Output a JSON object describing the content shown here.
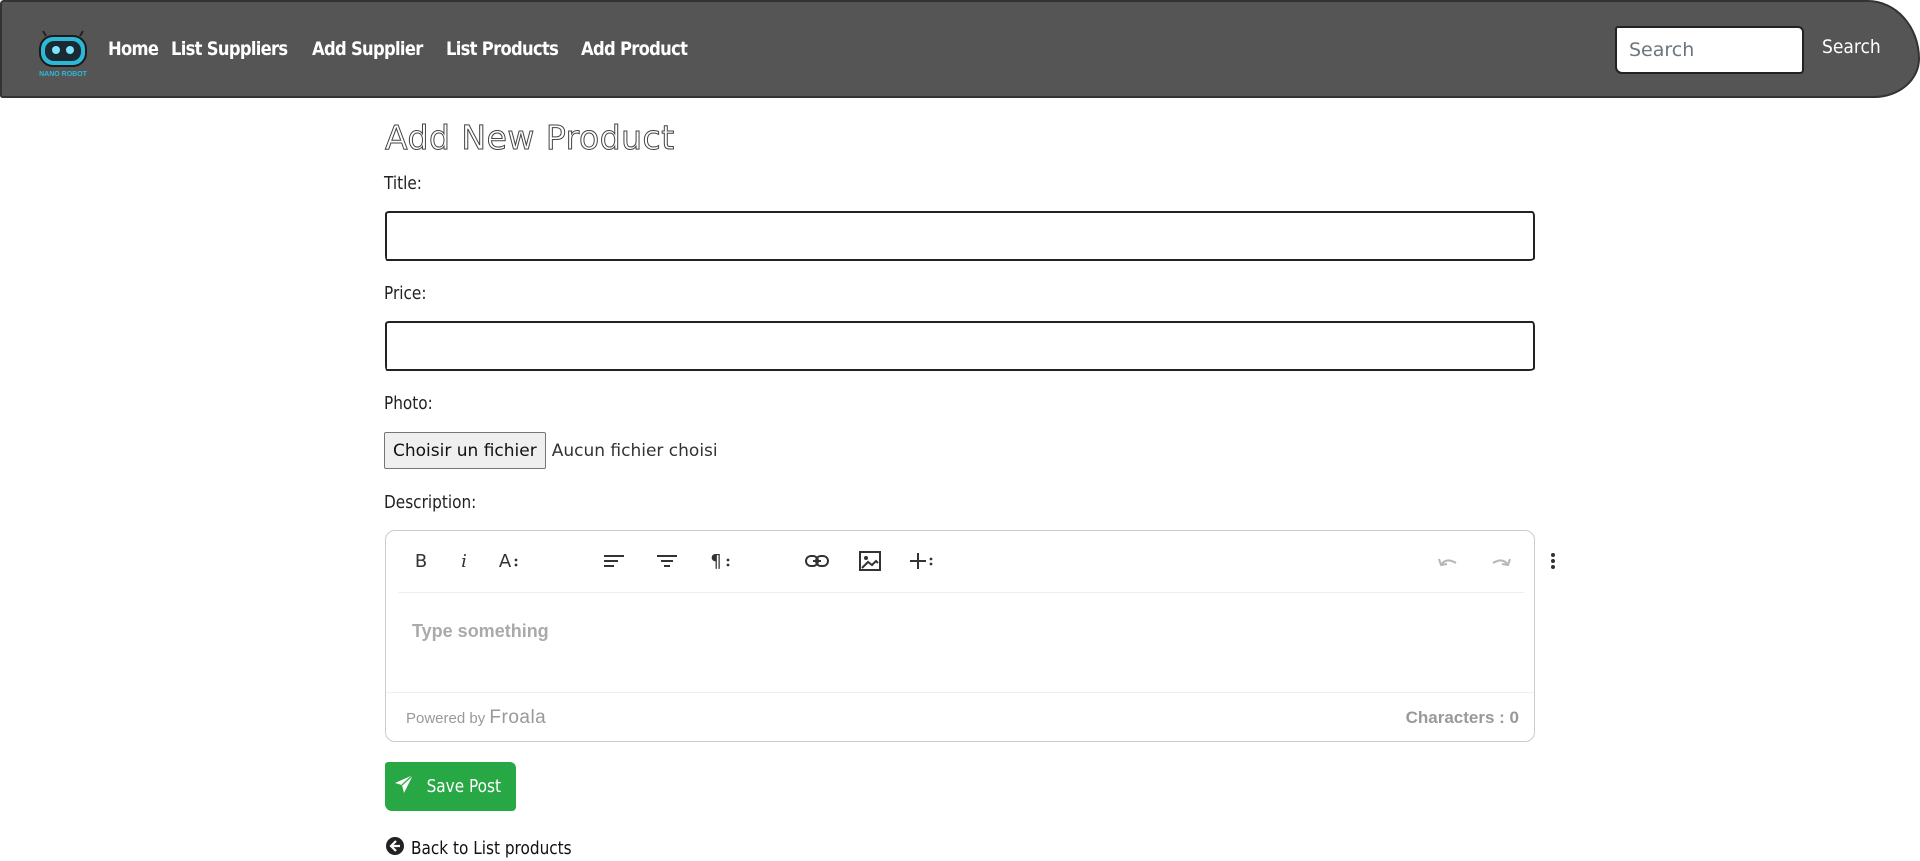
{
  "navbar": {
    "logo_text": "NANO ROBOT",
    "links": [
      "Home",
      "List Suppliers",
      "Add Supplier",
      "List Products",
      "Add Product"
    ],
    "search_placeholder": "Search",
    "search_button": "Search",
    "background_color": "#555555"
  },
  "form": {
    "page_title": "Add New Product",
    "title_label": "Title:",
    "title_value": "",
    "price_label": "Price:",
    "price_value": "",
    "photo_label": "Photo:",
    "file_button": "Choisir un fichier",
    "file_status": "Aucun fichier choisi",
    "description_label": "Description:"
  },
  "editor": {
    "toolbar": [
      "bold-icon",
      "italic-icon",
      "text-format-icon",
      "align-left-icon",
      "align-center-icon",
      "paragraph-format-icon",
      "link-icon",
      "image-icon",
      "more-insert-icon",
      "undo-icon",
      "redo-icon",
      "more-options-icon"
    ],
    "placeholder": "Type something",
    "powered_by": "Powered by",
    "brand": "Froala",
    "char_count": "Characters : 0"
  },
  "actions": {
    "save_label": "Save Post",
    "save_color": "#28a745",
    "back_label": "Back to List products"
  }
}
